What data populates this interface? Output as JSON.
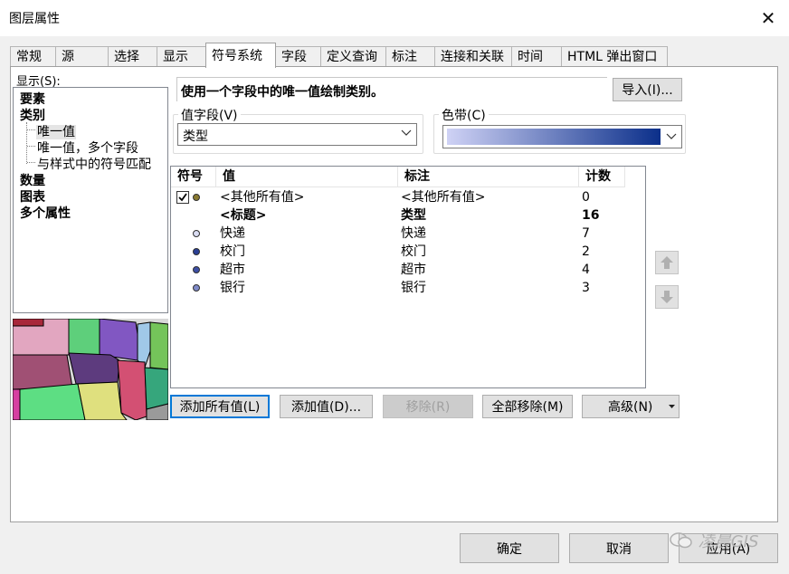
{
  "window": {
    "title": "图层属性",
    "close_glyph": "✕"
  },
  "tabs": [
    {
      "label": "常规"
    },
    {
      "label": "源"
    },
    {
      "label": "选择"
    },
    {
      "label": "显示"
    },
    {
      "label": "符号系统"
    },
    {
      "label": "字段"
    },
    {
      "label": "定义查询"
    },
    {
      "label": "标注"
    },
    {
      "label": "连接和关联"
    },
    {
      "label": "时间"
    },
    {
      "label": "HTML 弹出窗口"
    }
  ],
  "active_tab": "符号系统",
  "show": {
    "label": "显示(S):",
    "items": [
      {
        "label": "要素"
      },
      {
        "label": "类别"
      },
      {
        "label": "唯一值"
      },
      {
        "label": "唯一值，多个字段"
      },
      {
        "label": "与样式中的符号匹配"
      },
      {
        "label": "数量"
      },
      {
        "label": "图表"
      },
      {
        "label": "多个属性"
      }
    ]
  },
  "description": "使用一个字段中的唯一值绘制类别。",
  "import_button": "导入(I)...",
  "value_field": {
    "label": "值字段(V)",
    "value": "类型"
  },
  "color_ramp": {
    "label": "色带(C)",
    "start_color": "#cfd2f5",
    "end_color": "#0b2f8a"
  },
  "table": {
    "headers": {
      "symbol": "符号",
      "value": "值",
      "label": "标注",
      "count": "计数"
    },
    "rows": [
      {
        "value": "<其他所有值>",
        "label": "<其他所有值>",
        "count": "0",
        "color": "#8a7a30",
        "checked": true
      },
      {
        "value": "<标题>",
        "label": "类型",
        "count": "16",
        "bold": true
      },
      {
        "value": "快递",
        "label": "快递",
        "count": "7",
        "color": "#d9dcf2"
      },
      {
        "value": "校门",
        "label": "校门",
        "count": "2",
        "color": "#2a3f95"
      },
      {
        "value": "超市",
        "label": "超市",
        "count": "4",
        "color": "#3d4fa5"
      },
      {
        "value": "银行",
        "label": "银行",
        "count": "3",
        "color": "#7f8ac8"
      }
    ]
  },
  "buttons": {
    "add_all": "添加所有值(L)",
    "add_values": "添加值(D)...",
    "remove": "移除(R)",
    "remove_all": "全部移除(M)",
    "advanced": "高级(N)"
  },
  "footer": {
    "ok": "确定",
    "cancel": "取消",
    "apply": "应用(A)"
  },
  "watermark": "凌晨GIS",
  "icons": {
    "up": "arrow-up-icon",
    "down": "arrow-down-icon",
    "chevron": "chevron-down-icon",
    "check": "checkmark-icon",
    "close": "close-icon",
    "wechat": "wechat-icon"
  }
}
